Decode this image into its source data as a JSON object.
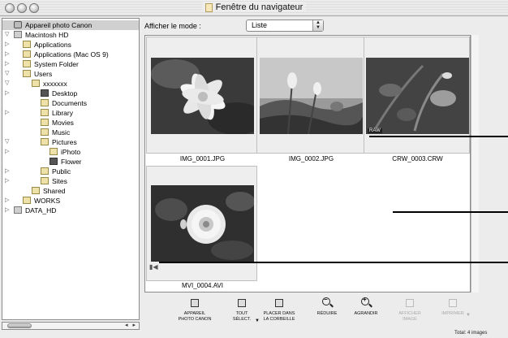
{
  "window": {
    "title": "Fenêtre du navigateur"
  },
  "sidebar": {
    "items": [
      {
        "label": "Appareil photo Canon",
        "disclosure": "",
        "icon": "camera-icon",
        "indent": 0,
        "selected": true
      },
      {
        "label": "Macintosh HD",
        "disclosure": "▽",
        "icon": "harddisk-icon",
        "indent": 0
      },
      {
        "label": "Applications",
        "disclosure": "▷",
        "icon": "folder-icon",
        "indent": 1
      },
      {
        "label": "Applications (Mac OS 9)",
        "disclosure": "▷",
        "icon": "folder-icon",
        "indent": 1
      },
      {
        "label": "System Folder",
        "disclosure": "▷",
        "icon": "folder-icon",
        "indent": 1
      },
      {
        "label": "Users",
        "disclosure": "▽",
        "icon": "folder-icon",
        "indent": 1
      },
      {
        "label": "xxxxxxx",
        "disclosure": "▽",
        "icon": "home-icon",
        "indent": 2
      },
      {
        "label": "Desktop",
        "disclosure": "▷",
        "icon": "desktop-folder-icon",
        "indent": 3
      },
      {
        "label": "Documents",
        "disclosure": "",
        "icon": "folder-icon",
        "indent": 3
      },
      {
        "label": "Library",
        "disclosure": "▷",
        "icon": "folder-icon",
        "indent": 3
      },
      {
        "label": "Movies",
        "disclosure": "",
        "icon": "folder-icon",
        "indent": 3
      },
      {
        "label": "Music",
        "disclosure": "",
        "icon": "folder-icon",
        "indent": 3
      },
      {
        "label": "Pictures",
        "disclosure": "▽",
        "icon": "folder-icon",
        "indent": 3
      },
      {
        "label": "iPhoto",
        "disclosure": "▷",
        "icon": "folder-icon",
        "indent": 4
      },
      {
        "label": "Flower",
        "disclosure": "",
        "icon": "dark-folder-icon",
        "indent": 4
      },
      {
        "label": "Public",
        "disclosure": "▷",
        "icon": "folder-icon",
        "indent": 3
      },
      {
        "label": "Sites",
        "disclosure": "▷",
        "icon": "folder-icon",
        "indent": 3
      },
      {
        "label": "Shared",
        "disclosure": "",
        "icon": "folder-icon",
        "indent": 2
      },
      {
        "label": "WORKS",
        "disclosure": "▷",
        "icon": "folder-icon",
        "indent": 1
      },
      {
        "label": "DATA_HD",
        "disclosure": "▷",
        "icon": "harddisk-icon",
        "indent": 0
      }
    ]
  },
  "view": {
    "mode_label": "Afficher le mode :",
    "mode_value": "Liste"
  },
  "images": [
    {
      "filename": "IMG_0001.JPG",
      "tag": "",
      "scene": "lily"
    },
    {
      "filename": "IMG_0002.JPG",
      "tag": "",
      "scene": "flowers-sky"
    },
    {
      "filename": "CRW_0003.CRW",
      "tag": "RAW",
      "scene": "plant"
    },
    {
      "filename": "MVI_0004.AVI",
      "tag": "movie",
      "scene": "rose"
    }
  ],
  "toolbar": {
    "buttons": [
      {
        "line1": "APPAREIL",
        "line2": "PHOTO CANON",
        "icon": "camera-icon",
        "enabled": true,
        "dropdown": false
      },
      {
        "line1": "TOUT",
        "line2": "SÉLECT.",
        "icon": "select-all-icon",
        "enabled": true,
        "dropdown": true
      },
      {
        "line1": "PLACER DANS",
        "line2": "LA CORBEILLE",
        "icon": "trash-icon",
        "enabled": true,
        "dropdown": false
      },
      {
        "line1": "RÉDUIRE",
        "line2": "",
        "icon": "zoom-out-icon",
        "enabled": true,
        "dropdown": false
      },
      {
        "line1": "AGRANDIR",
        "line2": "",
        "icon": "zoom-in-icon",
        "enabled": true,
        "dropdown": false
      },
      {
        "line1": "AFFICHER",
        "line2": "IMAGE",
        "icon": "view-image-icon",
        "enabled": false,
        "dropdown": false
      },
      {
        "line1": "IMPRIMER",
        "line2": "",
        "icon": "print-icon",
        "enabled": false,
        "dropdown": true
      }
    ]
  },
  "status": {
    "total": "Total: 4 images"
  },
  "colors": {
    "window_bg": "#ececec",
    "selection": "#d0d0d0",
    "cell_bg": "#eeeeee"
  }
}
